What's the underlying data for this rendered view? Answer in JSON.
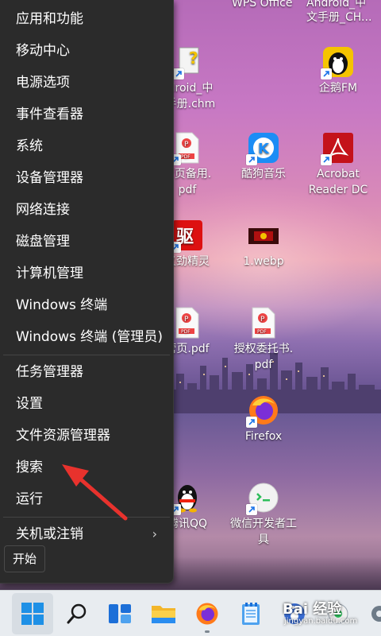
{
  "menu": {
    "items": [
      {
        "label": "应用和功能"
      },
      {
        "label": "移动中心"
      },
      {
        "label": "电源选项"
      },
      {
        "label": "事件查看器"
      },
      {
        "label": "系统"
      },
      {
        "label": "设备管理器"
      },
      {
        "label": "网络连接"
      },
      {
        "label": "磁盘管理"
      },
      {
        "label": "计算机管理"
      },
      {
        "label": "Windows 终端"
      },
      {
        "label": "Windows 终端 (管理员)"
      },
      {
        "label": "任务管理器"
      },
      {
        "label": "设置"
      },
      {
        "label": "文件资源管理器"
      },
      {
        "label": "搜索"
      },
      {
        "label": "运行"
      },
      {
        "label": "关机或注销"
      }
    ],
    "submenu_arrow": "›",
    "tooltip": "开始"
  },
  "desktop": {
    "top_labels": [
      "WPS Office",
      "Android_中",
      "文手册_CH..."
    ],
    "icons": [
      {
        "label": "droid_中\n手册.chm",
        "icon": "chm-help-icon"
      },
      {
        "label": "企鹅FM",
        "icon": "penguin-fm-icon"
      },
      {
        "label": "营页备用.\npdf",
        "icon": "pdf-file-icon"
      },
      {
        "label": "酷狗音乐",
        "icon": "kugou-music-icon"
      },
      {
        "label": "Acrobat\nReader DC",
        "icon": "acrobat-reader-icon"
      },
      {
        "label": "又劲精灵",
        "icon": "red-app-icon"
      },
      {
        "label": "1.webp",
        "icon": "image-file-icon"
      },
      {
        "label": "营页.pdf",
        "icon": "pdf-file-icon"
      },
      {
        "label": "授权委托书.\npdf",
        "icon": "pdf-file-icon"
      },
      {
        "label": "Firefox",
        "icon": "firefox-icon"
      },
      {
        "label": "腾讯QQ",
        "icon": "qq-icon"
      },
      {
        "label": "微信开发者工\n具",
        "icon": "wechat-devtools-icon"
      }
    ]
  },
  "taskbar": {
    "icons": [
      "windows-start-icon",
      "search-icon",
      "widgets-icon",
      "file-explorer-icon",
      "firefox-icon",
      "notepad-icon",
      "baidu-icon",
      "settings-icon"
    ]
  },
  "watermark": {
    "text": "Bai 经验",
    "url": "jingyan.baidu.com"
  },
  "colors": {
    "menu_bg": "#2b2b2b",
    "arrow": "#e8322d",
    "taskbar_bg": "#e8ecf0"
  }
}
